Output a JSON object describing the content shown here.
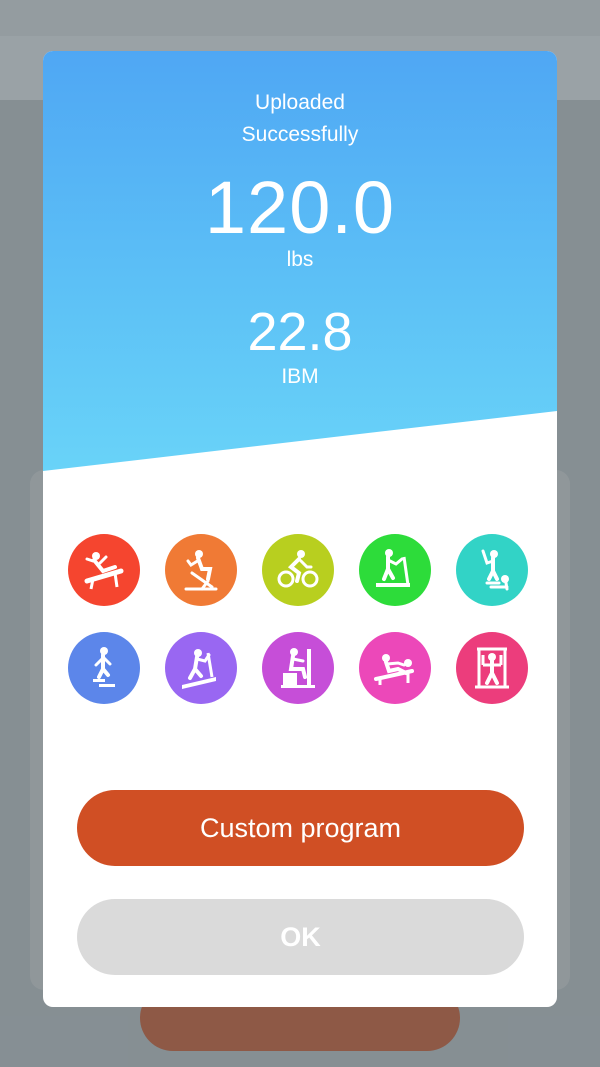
{
  "dialog": {
    "status_line1": "Uploaded",
    "status_line2": "Successfully",
    "weight_value": "120.0",
    "weight_unit": "lbs",
    "bmi_value": "22.8",
    "bmi_unit": "IBM"
  },
  "equipment_icons": [
    {
      "name": "bench-icon",
      "color": "#f5452f"
    },
    {
      "name": "exercise-bike-icon",
      "color": "#f07a35"
    },
    {
      "name": "bicycle-icon",
      "color": "#b8cf1f"
    },
    {
      "name": "treadmill-icon",
      "color": "#2ddc3a"
    },
    {
      "name": "elliptical-icon",
      "color": "#32d3c6"
    },
    {
      "name": "stepper-icon",
      "color": "#5c86ea"
    },
    {
      "name": "incline-treadmill-icon",
      "color": "#9967f2"
    },
    {
      "name": "rowing-seat-icon",
      "color": "#c64ed8"
    },
    {
      "name": "rowing-machine-icon",
      "color": "#ec48b9"
    },
    {
      "name": "multi-gym-icon",
      "color": "#ec3d7c"
    }
  ],
  "buttons": {
    "custom_program": "Custom program",
    "ok": "OK"
  }
}
